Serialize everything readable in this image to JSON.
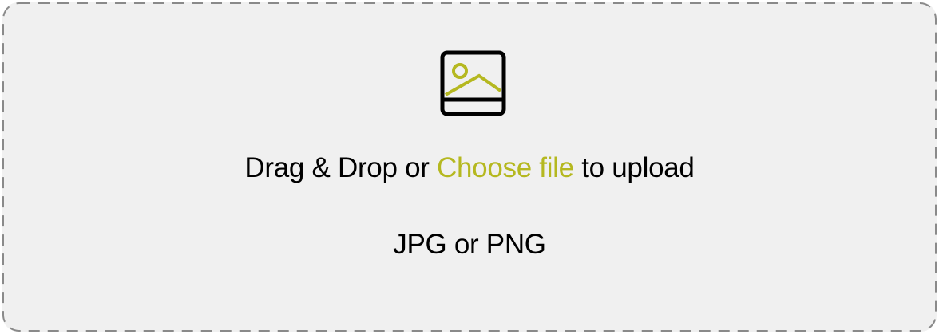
{
  "upload": {
    "prompt_before": "Drag & Drop or ",
    "choose_link": "Choose file",
    "prompt_after": " to upload",
    "formats": "JPG or PNG",
    "icon": "image-icon"
  },
  "colors": {
    "accent": "#b5b820",
    "background": "#f0f0f0",
    "border": "#8a8a8a",
    "text": "#000000"
  }
}
